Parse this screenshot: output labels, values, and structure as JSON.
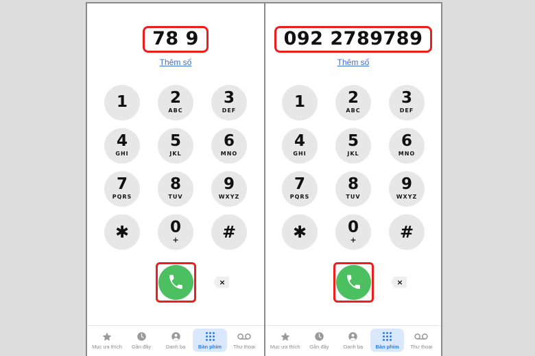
{
  "app": {
    "background_color": "#dcdcdc",
    "panel_border_color": "#8a8a8a",
    "highlight_color": "#ef1c1c",
    "accent_color": "#2a7cf0",
    "call_button_color": "#4cc061",
    "key_color": "#e7e7e7"
  },
  "panels": [
    {
      "id": "left",
      "display": {
        "number": "78 9",
        "add_number_link": "Thêm số",
        "highlighted": true
      }
    },
    {
      "id": "right",
      "display": {
        "number": "092 2789789",
        "add_number_link": "Thêm số",
        "highlighted": true
      }
    }
  ],
  "keypad": {
    "rows": [
      [
        {
          "digit": "1",
          "letters": ""
        },
        {
          "digit": "2",
          "letters": "ABC"
        },
        {
          "digit": "3",
          "letters": "DEF"
        }
      ],
      [
        {
          "digit": "4",
          "letters": "GHI"
        },
        {
          "digit": "5",
          "letters": "JKL"
        },
        {
          "digit": "6",
          "letters": "MNO"
        }
      ],
      [
        {
          "digit": "7",
          "letters": "PQRS"
        },
        {
          "digit": "8",
          "letters": "TUV"
        },
        {
          "digit": "9",
          "letters": "WXYZ"
        }
      ],
      [
        {
          "digit": "✱",
          "letters": ""
        },
        {
          "digit": "0",
          "letters": "+"
        },
        {
          "digit": "#",
          "letters": ""
        }
      ]
    ]
  },
  "call_row": {
    "call_icon": "phone-icon",
    "backspace_icon": "backspace-icon",
    "backspace_glyph": "×",
    "call_highlighted": true
  },
  "tabbar": {
    "tabs": [
      {
        "label": "Mục ưa thích",
        "icon": "star-icon",
        "active": false
      },
      {
        "label": "Gần đây",
        "icon": "clock-icon",
        "active": false
      },
      {
        "label": "Danh bạ",
        "icon": "person-icon",
        "active": false
      },
      {
        "label": "Bàn phím",
        "icon": "keypad-icon",
        "active": true
      },
      {
        "label": "Thư thoại",
        "icon": "voicemail-icon",
        "active": false
      }
    ]
  }
}
